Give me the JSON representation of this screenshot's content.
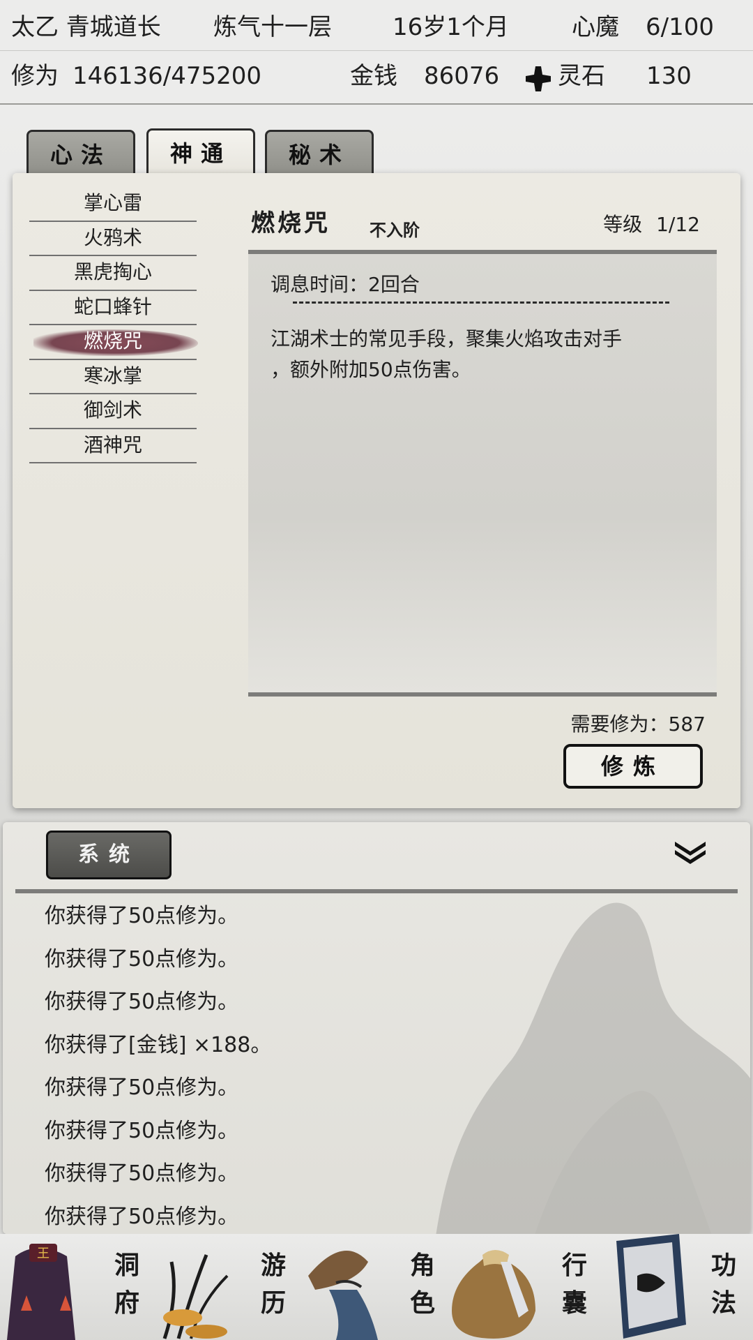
{
  "status": {
    "name": "太乙 青城道长",
    "realm": "炼气十一层",
    "age": "16岁1个月",
    "demon_label": "心魔",
    "demon_value": "6/100",
    "cultivation_label": "修为",
    "cultivation_value": "146136/475200",
    "money_label": "金钱",
    "money_value": "86076",
    "stone_label": "灵石",
    "stone_value": "130"
  },
  "tabs": [
    {
      "label": "心法"
    },
    {
      "label": "神通"
    },
    {
      "label": "秘术"
    }
  ],
  "active_tab": "神通",
  "skills": [
    {
      "label": "掌心雷"
    },
    {
      "label": "火鸦术"
    },
    {
      "label": "黑虎掏心"
    },
    {
      "label": "蛇口蜂针"
    },
    {
      "label": "燃烧咒"
    },
    {
      "label": "寒冰掌"
    },
    {
      "label": "御剑术"
    },
    {
      "label": "酒神咒"
    }
  ],
  "selected_skill": "燃烧咒",
  "detail": {
    "title": "燃烧咒",
    "grade": "不入阶",
    "level_label": "等级",
    "level_value": "1/12",
    "cooldown": "调息时间：2回合",
    "description_line1": "江湖术士的常见手段，聚集火焰攻击对手",
    "description_line2": "，额外附加50点伤害。",
    "need_exp": "需要修为：587",
    "train_button": "修炼"
  },
  "log": {
    "tab_label": "系统",
    "lines": [
      "你获得了50点修为。",
      "你获得了50点修为。",
      "你获得了50点修为。",
      "你获得了[金钱] ×188。",
      "你获得了50点修为。",
      "你获得了50点修为。",
      "你获得了50点修为。",
      "你获得了50点修为。"
    ]
  },
  "nav": [
    {
      "label": "洞府",
      "icon": "cave-dwelling-icon"
    },
    {
      "label": "游历",
      "icon": "travel-grass-icon"
    },
    {
      "label": "角色",
      "icon": "character-hat-icon"
    },
    {
      "label": "行囊",
      "icon": "bag-icon"
    },
    {
      "label": "功法",
      "icon": "scripture-book-icon"
    }
  ],
  "colors": {
    "selected_ink": "#6b3341",
    "panel_bg": "#e9e7e0",
    "tab_inactive": "#9a9a94"
  }
}
